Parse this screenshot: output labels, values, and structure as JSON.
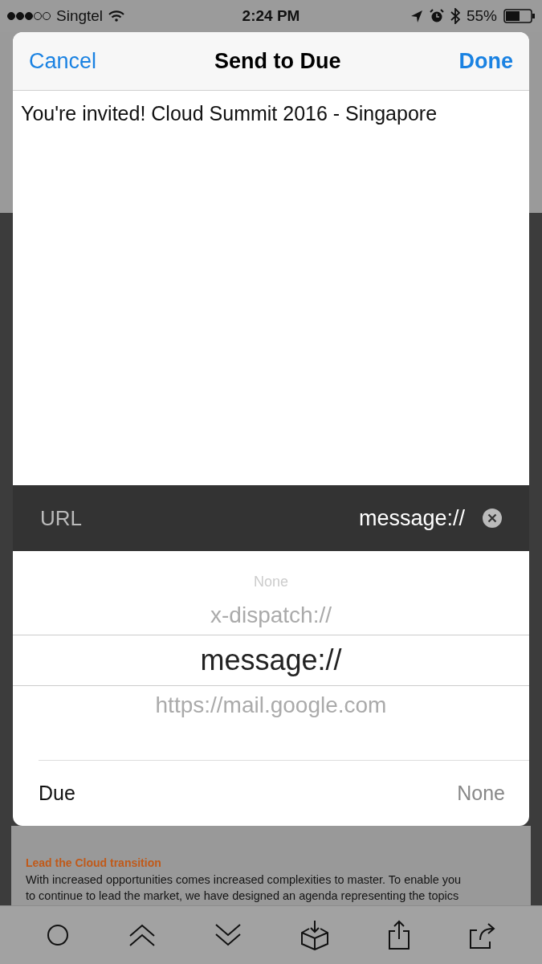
{
  "status_bar": {
    "carrier": "Singtel",
    "time": "2:24 PM",
    "battery": "55%"
  },
  "sheet": {
    "title": "Send to Due",
    "cancel": "Cancel",
    "done": "Done",
    "note": "You're invited! Cloud Summit 2016 - Singapore",
    "url_row": {
      "label": "URL",
      "value": "message://"
    },
    "picker": [
      {
        "label": "None",
        "selected": false
      },
      {
        "label": "x-dispatch://",
        "selected": false
      },
      {
        "label": "message://",
        "selected": true
      },
      {
        "label": "https://mail.google.com",
        "selected": false
      }
    ],
    "due_row": {
      "label": "Due",
      "value": "None"
    }
  },
  "background_page": {
    "heading": "Lead the Cloud transition",
    "lines": [
      "With increased opportunities comes increased complexities to master. To enable you",
      "to continue to lead the market, we have designed an agenda representing the topics"
    ]
  },
  "toolbar": [
    {
      "kind": "circle"
    },
    {
      "kind": "up"
    },
    {
      "kind": "down"
    },
    {
      "kind": "box"
    },
    {
      "kind": "share"
    },
    {
      "kind": "forward"
    }
  ]
}
